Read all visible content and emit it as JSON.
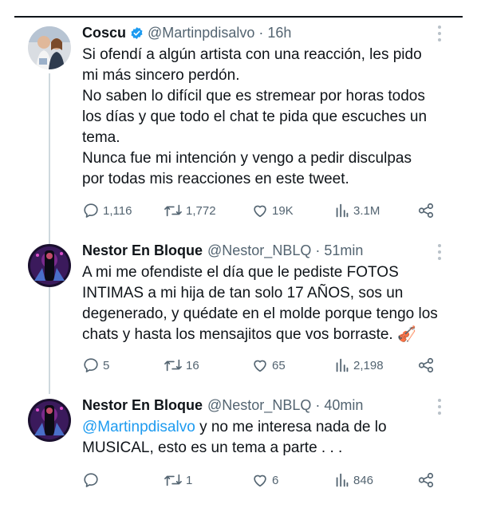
{
  "tweets": [
    {
      "name": "Coscu",
      "verified": true,
      "handle": "@Martinpdisalvo",
      "time": "16h",
      "lines": [
        "Si ofendí a algún artista con una reacción, les pido",
        "mi más sincero perdón.",
        "No saben lo difícil que es stremear por horas todos",
        "los días y que todo el chat te pida que escuches un",
        "tema.",
        "Nunca fue mi intención y vengo a pedir disculpas",
        "por todas mis reacciones en este tweet."
      ],
      "replies": "1,116",
      "retweets": "1,772",
      "likes": "19K",
      "views": "3.1M"
    },
    {
      "name": "Nestor En Bloque",
      "verified": false,
      "handle": "@Nestor_NBLQ",
      "time": "51min",
      "lines": [
        "A mi me ofendiste el día que le pediste FOTOS",
        "INTIMAS a mi hija de tan solo 17 AÑOS, sos un",
        "degenerado, y quédate en el molde porque tengo los",
        "chats y hasta los mensajitos que vos borraste. 🎻"
      ],
      "replies": "5",
      "retweets": "16",
      "likes": "65",
      "views": "2,198"
    },
    {
      "name": "Nestor En Bloque",
      "verified": false,
      "handle": "@Nestor_NBLQ",
      "time": "40min",
      "mention": "@Martinpdisalvo",
      "first_line_rest": " y no me interesa nada de lo",
      "lines": [
        "MUSICAL, esto es un tema a parte . . ."
      ],
      "replies": "",
      "retweets": "1",
      "likes": "6",
      "views": "846"
    }
  ],
  "icons": {
    "reply": "reply-icon",
    "retweet": "retweet-icon",
    "like": "heart-icon",
    "views": "views-icon",
    "share": "share-icon",
    "verified": "verified-badge-icon",
    "more": "more-icon"
  },
  "colors": {
    "text": "#0f1419",
    "secondary": "#536471",
    "link": "#1d9bf0",
    "verified": "#1d9bf0",
    "thread_line": "#cfd9de"
  },
  "dot_separator": "·"
}
